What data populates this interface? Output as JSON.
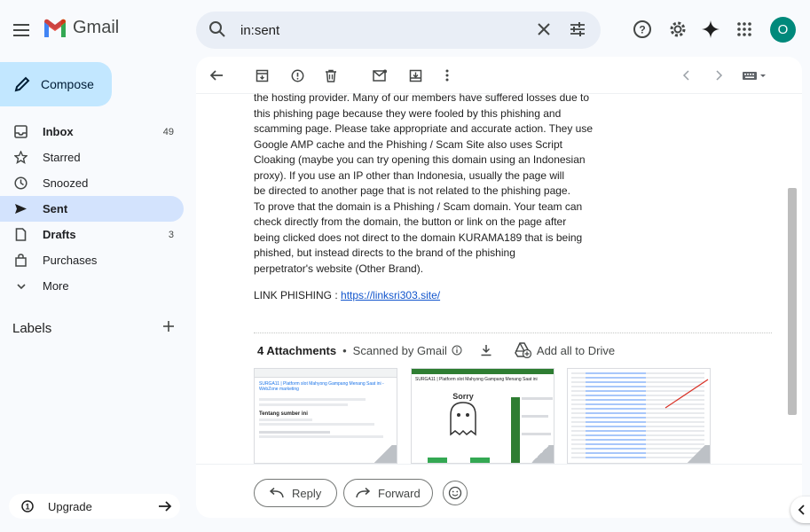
{
  "app": {
    "logo_text": "Gmail",
    "avatar_letter": "O"
  },
  "search": {
    "value": "in:sent"
  },
  "compose_label": "Compose",
  "sidebar": {
    "items": [
      {
        "label": "Inbox",
        "count": "49",
        "icon": "inbox-icon"
      },
      {
        "label": "Starred",
        "count": "",
        "icon": "star-icon"
      },
      {
        "label": "Snoozed",
        "count": "",
        "icon": "clock-icon"
      },
      {
        "label": "Sent",
        "count": "",
        "icon": "send-icon"
      },
      {
        "label": "Drafts",
        "count": "3",
        "icon": "draft-icon"
      },
      {
        "label": "Purchases",
        "count": "",
        "icon": "bag-icon"
      },
      {
        "label": "More",
        "count": "",
        "icon": "chevron-down-icon"
      }
    ],
    "labels_heading": "Labels",
    "upgrade_label": "Upgrade"
  },
  "message": {
    "lines": [
      "the hosting provider. Many of our members have suffered losses due to",
      "this phishing page because they were fooled by this phishing and",
      "scamming page. Please take appropriate and accurate action. They use",
      "Google AMP cache and the Phishing / Scam Site also uses Script",
      "Cloaking (maybe you can try opening this domain using an Indonesian",
      "proxy). If you use an IP other than Indonesia, usually the page will",
      "be directed to another page that is not related to the phishing page.",
      "To prove that the domain is a Phishing / Scam domain. Your team can",
      "check directly from the domain, the button or link on the page after",
      "being clicked does not direct to the domain KURAMA189 that is being",
      "phished, but instead directs to the brand of the phishing",
      "perpetrator's website (Other Brand)."
    ],
    "link_label": "LINK PHISHING : ",
    "link_url": "https://linksri303.site/"
  },
  "attachments": {
    "count_label": "4 Attachments",
    "separator": "•",
    "scanned_label": "Scanned by Gmail",
    "add_all_label": "Add all to Drive",
    "thumb1_title": "SURGA11 | Platform slot Mahyong Gampang Menang Saat ini - WebZone marketing",
    "thumb1_heading": "Tentang sumber ini",
    "thumb2_title": "SURGA11 | Platform slot Mahyong Gampang Menang Saat ini",
    "thumb2_sorry": "Sorry"
  },
  "reply": {
    "reply_label": "Reply",
    "forward_label": "Forward"
  },
  "colors": {
    "accent": "#0b57d0",
    "compose_bg": "#c2e7ff",
    "active_nav": "#d3e3fd",
    "avatar": "#00897b"
  }
}
